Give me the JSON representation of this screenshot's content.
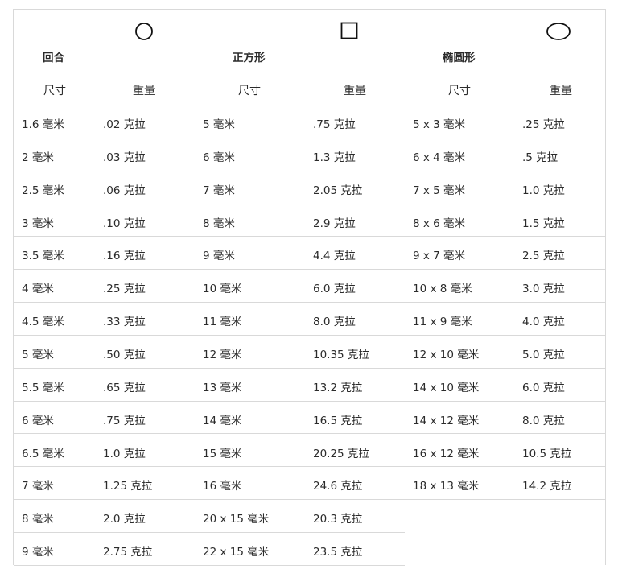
{
  "shapes": {
    "round": {
      "title": "回合",
      "icon": "circle-icon"
    },
    "square": {
      "title": "正方形",
      "icon": "square-icon"
    },
    "oval": {
      "title": "椭圆形",
      "icon": "oval-icon"
    }
  },
  "columns": {
    "size": "尺寸",
    "weight": "重量"
  },
  "rows": [
    {
      "rs": "1.6 毫米",
      "rw": ".02 克拉",
      "ss": "5 毫米",
      "sw": ".75 克拉",
      "os": "5 x 3 毫米",
      "ow": ".25 克拉"
    },
    {
      "rs": "2 毫米",
      "rw": ".03 克拉",
      "ss": "6 毫米",
      "sw": "1.3 克拉",
      "os": "6 x 4 毫米",
      "ow": ".5 克拉"
    },
    {
      "rs": "2.5 毫米",
      "rw": ".06 克拉",
      "ss": "7 毫米",
      "sw": "2.05 克拉",
      "os": "7 x 5 毫米",
      "ow": "1.0 克拉"
    },
    {
      "rs": "3 毫米",
      "rw": ".10 克拉",
      "ss": "8 毫米",
      "sw": "2.9 克拉",
      "os": "8 x 6 毫米",
      "ow": "1.5 克拉"
    },
    {
      "rs": "3.5 毫米",
      "rw": ".16 克拉",
      "ss": "9 毫米",
      "sw": "4.4 克拉",
      "os": "9 x 7 毫米",
      "ow": "2.5 克拉"
    },
    {
      "rs": "4 毫米",
      "rw": ".25 克拉",
      "ss": "10 毫米",
      "sw": "6.0 克拉",
      "os": "10 x 8 毫米",
      "ow": "3.0 克拉"
    },
    {
      "rs": "4.5 毫米",
      "rw": ".33 克拉",
      "ss": "11 毫米",
      "sw": "8.0 克拉",
      "os": "11 x 9 毫米",
      "ow": "4.0 克拉"
    },
    {
      "rs": "5 毫米",
      "rw": ".50 克拉",
      "ss": "12 毫米",
      "sw": "10.35 克拉",
      "os": "12 x 10 毫米",
      "ow": "5.0 克拉"
    },
    {
      "rs": "5.5 毫米",
      "rw": ".65 克拉",
      "ss": "13 毫米",
      "sw": "13.2 克拉",
      "os": "14 x 10 毫米",
      "ow": "6.0 克拉"
    },
    {
      "rs": "6 毫米",
      "rw": ".75 克拉",
      "ss": "14 毫米",
      "sw": "16.5 克拉",
      "os": "14 x 12 毫米",
      "ow": "8.0 克拉"
    },
    {
      "rs": "6.5 毫米",
      "rw": "1.0 克拉",
      "ss": "15 毫米",
      "sw": "20.25 克拉",
      "os": "16 x 12 毫米",
      "ow": "10.5 克拉"
    },
    {
      "rs": "7 毫米",
      "rw": "1.25 克拉",
      "ss": "16 毫米",
      "sw": "24.6 克拉",
      "os": "18 x 13 毫米",
      "ow": "14.2 克拉"
    },
    {
      "rs": "8 毫米",
      "rw": "2.0 克拉",
      "ss": "20 x 15 毫米",
      "sw": "20.3 克拉",
      "os": "",
      "ow": ""
    },
    {
      "rs": "9 毫米",
      "rw": "2.75 克拉",
      "ss": "22 x 15 毫米",
      "sw": "23.5 克拉",
      "os": "",
      "ow": ""
    }
  ]
}
